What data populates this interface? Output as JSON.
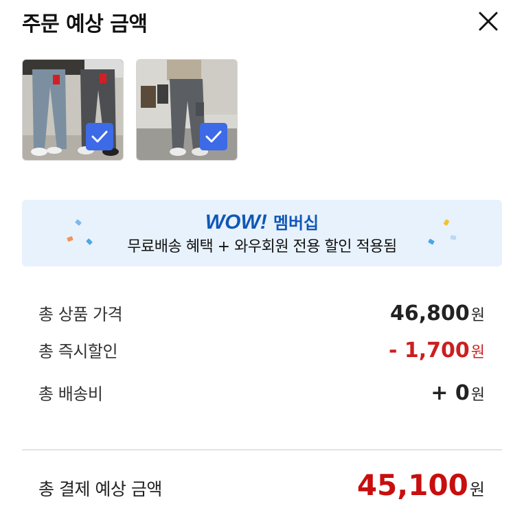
{
  "header": {
    "title": "주문 예상 금액",
    "close_icon": "close-icon"
  },
  "products": [
    {
      "selected": true,
      "check_icon": "checkmark-icon"
    },
    {
      "selected": true,
      "check_icon": "checkmark-icon"
    }
  ],
  "banner": {
    "brand": "WOW!",
    "membership": "멤버십",
    "description": "무료배송 혜택 + 와우회원 전용 할인 적용됨",
    "accent_color": "#0f57b8",
    "background_color": "#e8f2fc"
  },
  "summary": {
    "product_price_label": "총 상품 가격",
    "product_price_value": "46,800",
    "discount_label": "총 즉시할인",
    "discount_value": "- 1,700",
    "shipping_label": "총 배송비",
    "shipping_value": "+ 0",
    "currency": "원",
    "discount_color": "#cc1f1f"
  },
  "total": {
    "label": "총 결제 예상 금액",
    "value": "45,100",
    "currency": "원",
    "color": "#c80e0e"
  }
}
